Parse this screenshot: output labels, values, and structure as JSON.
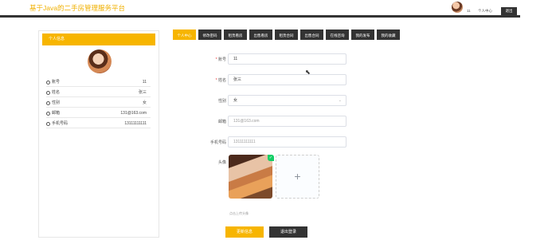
{
  "header": {
    "site_title": "基于Java的二手房管理服务平台",
    "username": "11",
    "center_link": "个人中心",
    "logout": "退出"
  },
  "sidebar": {
    "title": "个人信息",
    "rows": [
      {
        "label": "账号",
        "value": "11"
      },
      {
        "label": "姓名",
        "value": "张三"
      },
      {
        "label": "性别",
        "value": "女"
      },
      {
        "label": "邮箱",
        "value": "131@163.com"
      },
      {
        "label": "手机号码",
        "value": "13111111111"
      }
    ]
  },
  "tabs": [
    "个人中心",
    "修改密码",
    "租赁看房",
    "出售看房",
    "租赁合同",
    "出售合同",
    "在线咨询",
    "我的发布",
    "我的收藏"
  ],
  "form": {
    "account_label": "账号",
    "account_value": "11",
    "name_label": "姓名",
    "name_value": "张三",
    "gender_label": "性别",
    "gender_value": "女",
    "email_label": "邮箱",
    "email_value": "131@163.com",
    "phone_label": "手机号码",
    "phone_value": "13111111111",
    "avatar_label": "头像",
    "upload_tip": "点击上传头像",
    "upload_plus": "+"
  },
  "buttons": {
    "update": "更新信息",
    "logout": "退出登录"
  },
  "colors": {
    "accent": "#f7b500",
    "dark": "#333333"
  }
}
